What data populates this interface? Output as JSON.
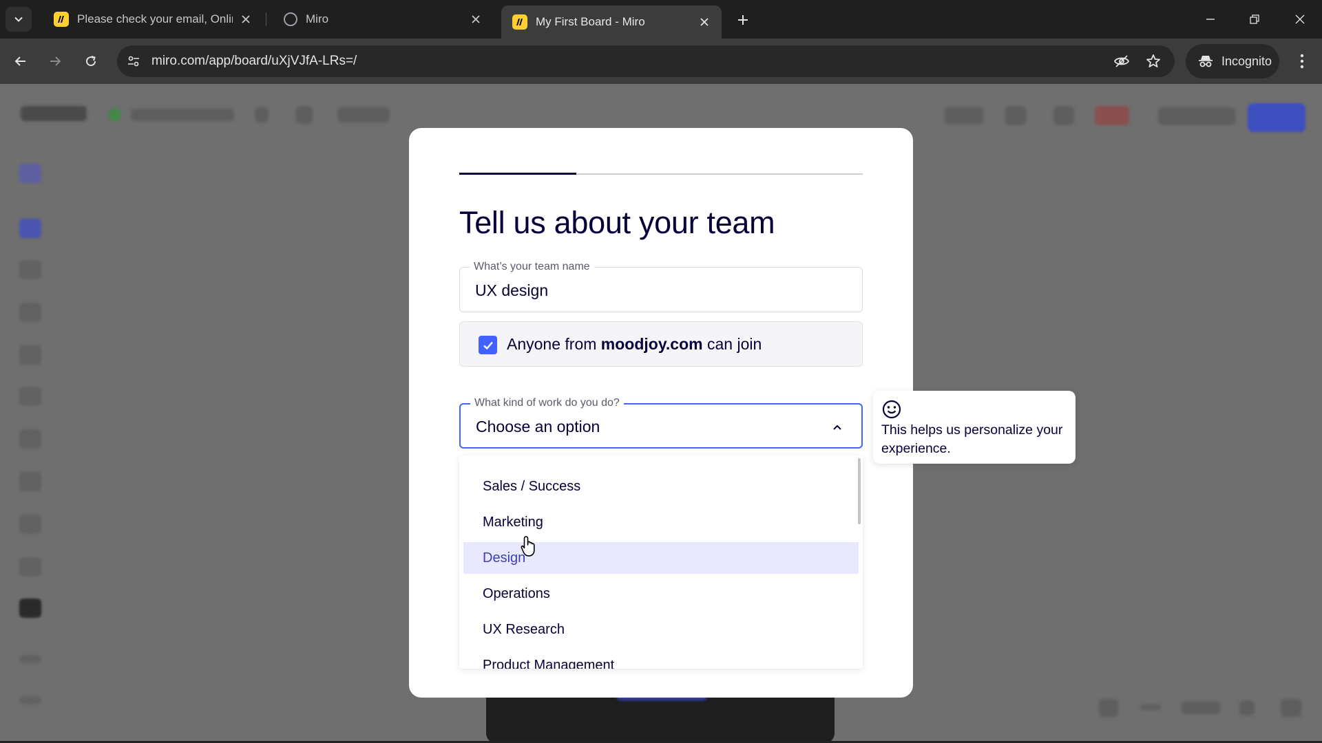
{
  "browser": {
    "tabs": [
      {
        "title": "Please check your email, Online"
      },
      {
        "title": "Miro"
      },
      {
        "title": "My First Board - Miro"
      }
    ],
    "url": "miro.com/app/board/uXjVJfA-LRs=/",
    "incognito_label": "Incognito"
  },
  "modal": {
    "heading": "Tell us about your team",
    "team_name": {
      "label": "What’s your team name",
      "value": "UX design"
    },
    "join": {
      "prefix": "Anyone from ",
      "domain": "moodjoy.com",
      "suffix": " can join",
      "checked": true
    },
    "work": {
      "label": "What kind of work do you do?",
      "value": "Choose an option"
    },
    "options": [
      "Sales / Success",
      "Marketing",
      "Design",
      "Operations",
      "UX Research",
      "Product Management"
    ],
    "highlighted_option": "Design",
    "progress": 0.29
  },
  "tooltip": {
    "text": "This helps us personalize your experience."
  },
  "colors": {
    "accent": "#4262ff",
    "text": "#050038",
    "highlight": "#e8e9ff",
    "brand_yellow": "#ffd02f"
  }
}
